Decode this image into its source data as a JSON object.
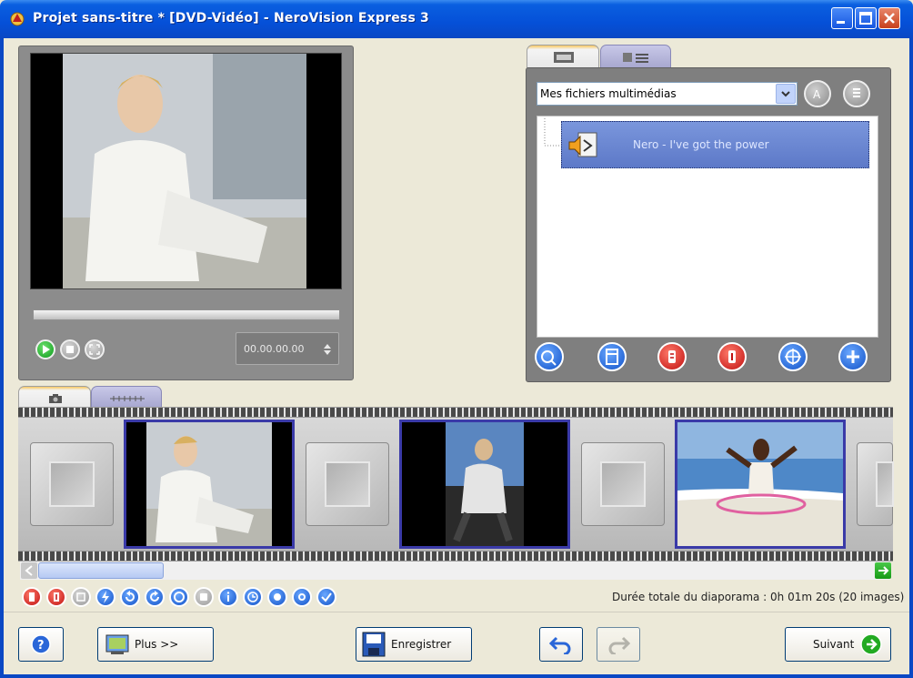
{
  "window": {
    "title": "Projet sans-titre * [DVD-Vidéo] - NeroVision Express 3"
  },
  "preview": {
    "timecode": "00.00.00.00"
  },
  "media": {
    "dropdown_value": "Mes fichiers multimédias",
    "items": [
      {
        "label": "Nero - I've got the power"
      }
    ]
  },
  "storyboard": {
    "duration_text": "Durée totale du diaporama : 0h 01m 20s (20 images)"
  },
  "buttons": {
    "more_label": "Plus >>",
    "save_label": "Enregistrer",
    "next_label": "Suivant"
  },
  "colors": {
    "titlebar": "#0550d8",
    "accent_blue": "#1252c8",
    "accent_red": "#c01010",
    "selection": "#6f8bd6"
  }
}
